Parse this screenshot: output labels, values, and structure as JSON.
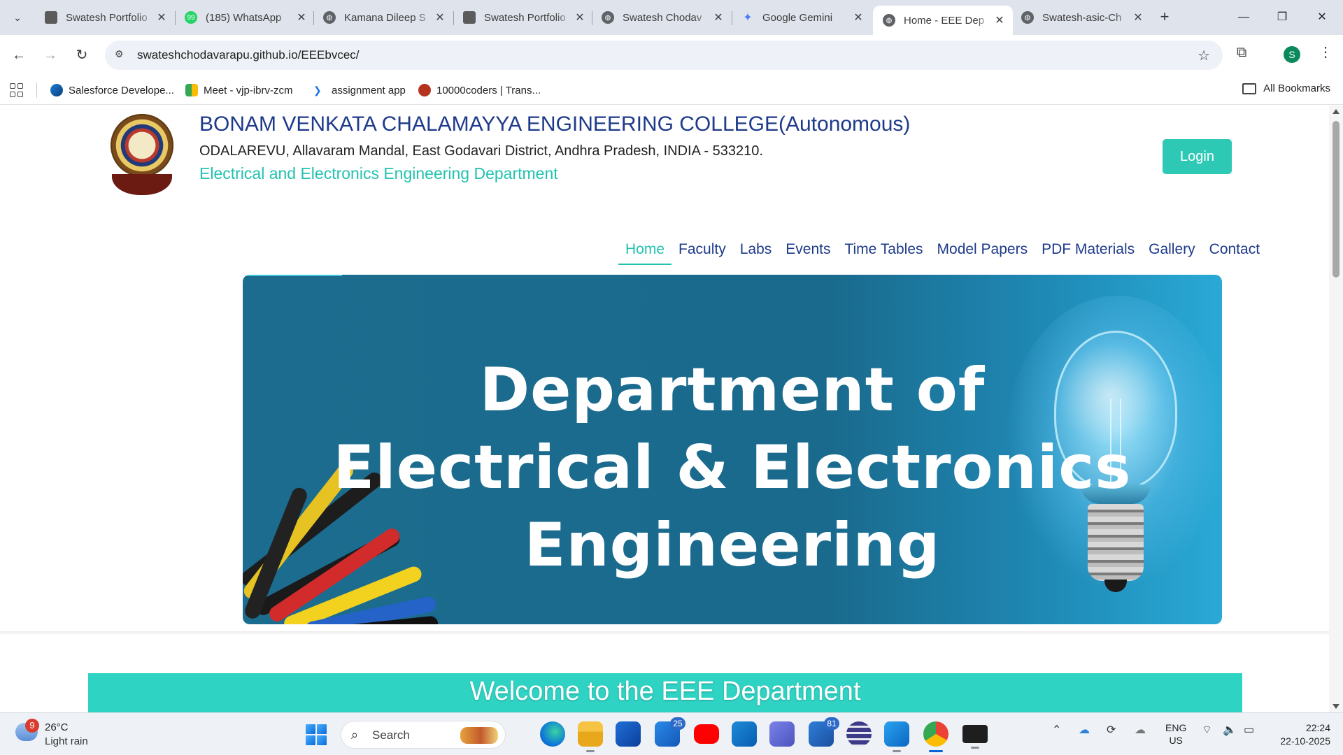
{
  "browser": {
    "tabs": [
      {
        "title": "Swatesh Portfolio",
        "favicon": "portrait-icon",
        "active": false
      },
      {
        "title": "(185) WhatsApp",
        "favicon": "whatsapp-icon",
        "active": false
      },
      {
        "title": "Kamana Dileep S",
        "favicon": "globe-icon",
        "active": false
      },
      {
        "title": "Swatesh Portfolio",
        "favicon": "portrait-icon",
        "active": false
      },
      {
        "title": "Swatesh Chodav",
        "favicon": "globe-icon",
        "active": false
      },
      {
        "title": "Google Gemini",
        "favicon": "gemini-icon",
        "active": false
      },
      {
        "title": "Home - EEE Dep",
        "favicon": "globe-icon",
        "active": true
      },
      {
        "title": "Swatesh-asic-Ch",
        "favicon": "globe-icon",
        "active": false
      }
    ],
    "url": "swateshchodavarapu.github.io/EEEbvcec/",
    "profile_initial": "S",
    "bookmarks": [
      {
        "label": "Salesforce Develope...",
        "icon": "salesforce-icon"
      },
      {
        "label": "Meet - vjp-ibrv-zcm",
        "icon": "meet-icon"
      },
      {
        "label": "assignment app",
        "icon": "app-icon"
      },
      {
        "label": "10000coders | Trans...",
        "icon": "coders-icon"
      }
    ],
    "all_bookmarks_label": "All Bookmarks"
  },
  "site": {
    "college_name": "BONAM VENKATA CHALAMAYYA ENGINEERING COLLEGE(Autonomous)",
    "address": "ODALAREVU, Allavaram Mandal, East Godavari District, Andhra Pradesh, INDIA - 533210.",
    "department": "Electrical and Electronics Engineering Department",
    "login_label": "Login",
    "nav": [
      {
        "label": "Home",
        "active": true
      },
      {
        "label": "Faculty",
        "active": false
      },
      {
        "label": "Labs",
        "active": false
      },
      {
        "label": "Events",
        "active": false
      },
      {
        "label": "Time Tables",
        "active": false
      },
      {
        "label": "Model Papers",
        "active": false
      },
      {
        "label": "PDF Materials",
        "active": false
      },
      {
        "label": "Gallery",
        "active": false
      },
      {
        "label": "Contact",
        "active": false
      }
    ],
    "banner_lines": [
      "Department of",
      "Electrical & Electronics",
      "Engineering"
    ],
    "welcome": "Welcome to the EEE Department",
    "colors": {
      "brand_blue": "#1e3a8a",
      "teal": "#22c2b0",
      "banner_blue": "#1c6c8f",
      "welcome_bar": "#2fd3c3"
    }
  },
  "taskbar": {
    "weather_temp": "26°C",
    "weather_desc": "Light rain",
    "weather_badge": "9",
    "search_label": "Search",
    "mail_badge": "25",
    "store_badge": "81",
    "lang_line1": "ENG",
    "lang_line2": "US",
    "time": "22:24",
    "date": "22-10-2025"
  }
}
